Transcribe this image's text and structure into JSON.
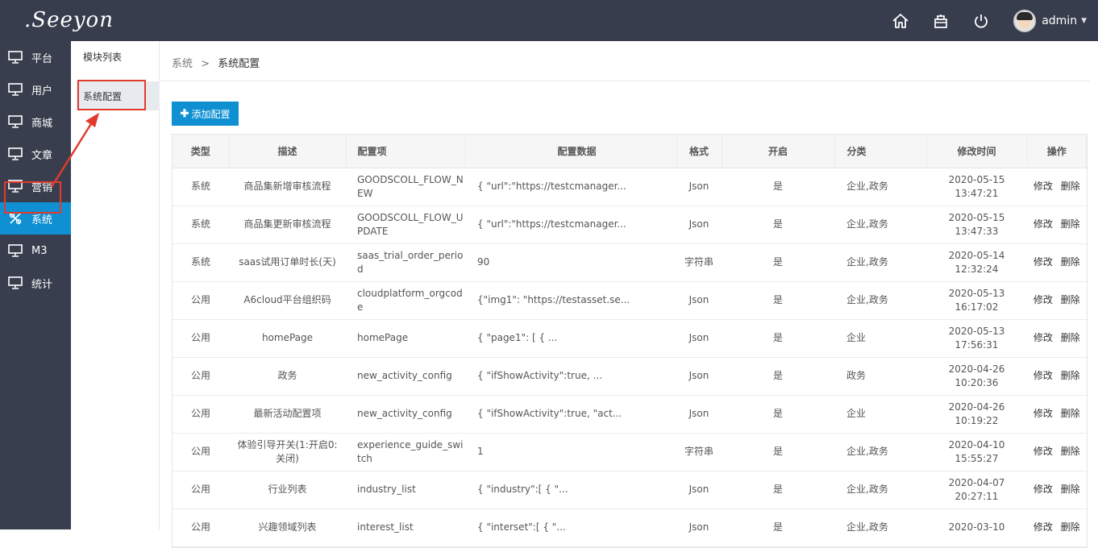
{
  "brand": {
    "logo_text": ".Seeyon"
  },
  "header": {
    "user_name": "admin"
  },
  "sidebar": {
    "items": [
      {
        "label": "平台",
        "icon": "monitor-icon"
      },
      {
        "label": "用户",
        "icon": "monitor-icon"
      },
      {
        "label": "商城",
        "icon": "monitor-icon"
      },
      {
        "label": "文章",
        "icon": "monitor-icon"
      },
      {
        "label": "营销",
        "icon": "monitor-icon"
      },
      {
        "label": "系统",
        "icon": "settings-icon",
        "active": true
      },
      {
        "label": "M3",
        "icon": "monitor-icon"
      },
      {
        "label": "统计",
        "icon": "monitor-icon"
      }
    ]
  },
  "subpanel": {
    "title": "模块列表",
    "active_item": "系统配置"
  },
  "breadcrumb": {
    "root": "系统",
    "sep": ">",
    "current": "系统配置"
  },
  "toolbar": {
    "add_label": "添加配置"
  },
  "table": {
    "headers": [
      "类型",
      "描述",
      "配置项",
      "配置数据",
      "格式",
      "开启",
      "分类",
      "修改时间",
      "操作"
    ],
    "edit_label": "修改",
    "delete_label": "删除",
    "rows": [
      {
        "type": "系统",
        "desc": "商品集新增审核流程",
        "key": "GOODSCOLL_FLOW_NEW",
        "data": "{ \"url\":\"https://testcmanager...",
        "format": "Json",
        "open": "是",
        "category": "企业,政务",
        "date": "2020-05-15",
        "time": "13:47:21"
      },
      {
        "type": "系统",
        "desc": "商品集更新审核流程",
        "key": "GOODSCOLL_FLOW_UPDATE",
        "data": "{ \"url\":\"https://testcmanager...",
        "format": "Json",
        "open": "是",
        "category": "企业,政务",
        "date": "2020-05-15",
        "time": "13:47:33"
      },
      {
        "type": "系统",
        "desc": "saas试用订单时长(天)",
        "key": "saas_trial_order_period",
        "data": "90",
        "format": "字符串",
        "open": "是",
        "category": "企业,政务",
        "date": "2020-05-14",
        "time": "12:32:24"
      },
      {
        "type": "公用",
        "desc": "A6cloud平台组织码",
        "key": "cloudplatform_orgcode",
        "data": "{\"img1\": \"https://testasset.se...",
        "format": "Json",
        "open": "是",
        "category": "企业,政务",
        "date": "2020-05-13",
        "time": "16:17:02"
      },
      {
        "type": "公用",
        "desc": "homePage",
        "key": "homePage",
        "data": "{ \"page1\": [ { ...",
        "format": "Json",
        "open": "是",
        "category": "企业",
        "date": "2020-05-13",
        "time": "17:56:31"
      },
      {
        "type": "公用",
        "desc": "政务",
        "key": "new_activity_config",
        "data": "{ \"ifShowActivity\":true, ...",
        "format": "Json",
        "open": "是",
        "category": "政务",
        "date": "2020-04-26",
        "time": "10:20:36"
      },
      {
        "type": "公用",
        "desc": "最新活动配置项",
        "key": "new_activity_config",
        "data": "{ \"ifShowActivity\":true, \"act...",
        "format": "Json",
        "open": "是",
        "category": "企业",
        "date": "2020-04-26",
        "time": "10:19:22"
      },
      {
        "type": "公用",
        "desc": "体验引导开关(1:开启0:关闭)",
        "key": "experience_guide_switch",
        "data": "1",
        "format": "字符串",
        "open": "是",
        "category": "企业,政务",
        "date": "2020-04-10",
        "time": "15:55:27"
      },
      {
        "type": "公用",
        "desc": "行业列表",
        "key": "industry_list",
        "data": "{ \"industry\":[ { \"...",
        "format": "Json",
        "open": "是",
        "category": "企业,政务",
        "date": "2020-04-07",
        "time": "20:27:11"
      },
      {
        "type": "公用",
        "desc": "兴趣领域列表",
        "key": "interest_list",
        "data": "{ \"interset\":[ { \"...",
        "format": "Json",
        "open": "是",
        "category": "企业,政务",
        "date": "2020-03-10",
        "time": ""
      }
    ]
  }
}
